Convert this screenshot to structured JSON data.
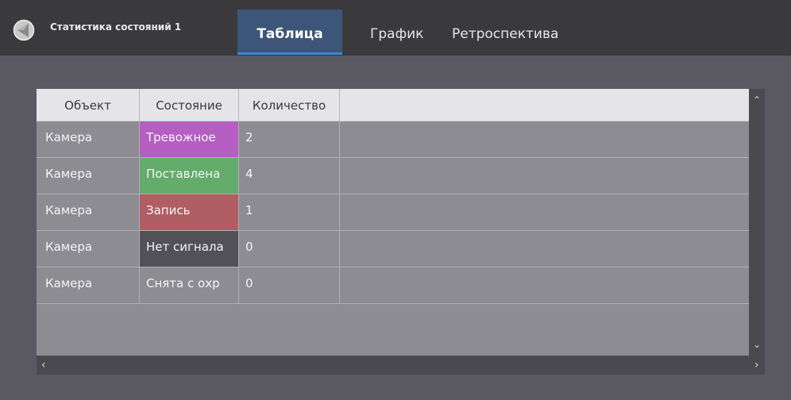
{
  "header": {
    "app_title": "Статистика состояний 1",
    "tabs": [
      {
        "label": "Таблица",
        "active": true
      },
      {
        "label": "График",
        "active": false
      },
      {
        "label": "Ретроспектива",
        "active": false
      }
    ]
  },
  "table": {
    "columns": [
      "Объект",
      "Состояние",
      "Количество"
    ],
    "rows": [
      {
        "object": "Камера",
        "state": "Тревожное",
        "count": "2",
        "state_color": "#b45fc1"
      },
      {
        "object": "Камера",
        "state": "Поставлена",
        "count": "4",
        "state_color": "#63ac6b"
      },
      {
        "object": "Камера",
        "state": "Запись",
        "count": "1",
        "state_color": "#b05e63"
      },
      {
        "object": "Камера",
        "state": "Нет сигнала",
        "count": "0",
        "state_color": "#535158"
      },
      {
        "object": "Камера",
        "state": "Снята с охр",
        "count": "0",
        "state_color": "#8e8c93"
      }
    ]
  },
  "scrollbars": {
    "up_glyph": "⌃",
    "down_glyph": "⌄",
    "left_glyph": "‹",
    "right_glyph": "›"
  },
  "colors": {
    "header_bg": "#3a3a3c",
    "active_tab_bg": "#3d5578",
    "active_tab_underline": "#3a86d8",
    "page_bg": "#5a5860",
    "table_bg": "#8e8c93"
  }
}
